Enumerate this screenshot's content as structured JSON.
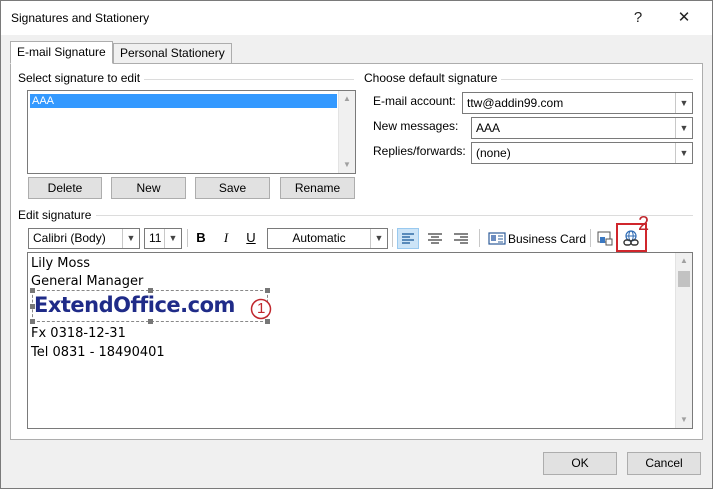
{
  "window": {
    "title": "Signatures and Stationery",
    "help_glyph": "?",
    "close_glyph": "✕"
  },
  "tabs": [
    {
      "label": "E-mail Signature",
      "active": true
    },
    {
      "label": "Personal Stationery",
      "active": false
    }
  ],
  "select_signature": {
    "label": "Select signature to edit",
    "items": [
      "AAA"
    ],
    "selected": "AAA"
  },
  "signature_buttons": {
    "delete": "Delete",
    "new": "New",
    "save": "Save",
    "rename": "Rename"
  },
  "default_signature": {
    "label": "Choose default signature",
    "email_account_label": "E-mail account:",
    "email_account_value": "ttw@addin99.com",
    "new_messages_label": "New messages:",
    "new_messages_value": "AAA",
    "replies_label": "Replies/forwards:",
    "replies_value": "(none)"
  },
  "edit_signature": {
    "label": "Edit signature",
    "font_name": "Calibri (Body)",
    "font_size": "11",
    "bold": "B",
    "italic": "I",
    "underline": "U",
    "color": "Automatic",
    "business_card": "Business Card"
  },
  "signature_content": {
    "line1": "Lily Moss",
    "line2": "General Manager",
    "logo_text": "ExtendOffice.com",
    "line4": "Fx 0318-12-31",
    "line5": "Tel 0831 - 18490401"
  },
  "annotations": {
    "marker1": "1",
    "marker2": "2",
    "accent_color": "#c0272d"
  },
  "footer": {
    "ok": "OK",
    "cancel": "Cancel"
  }
}
